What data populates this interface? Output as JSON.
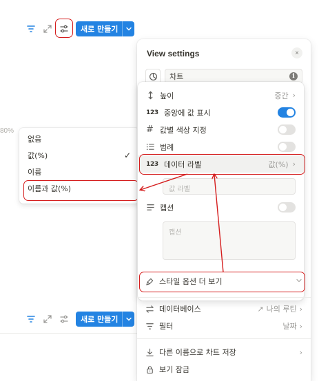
{
  "toolbar_top": {
    "new_label": "새로 만들기"
  },
  "toolbar_bottom": {
    "new_label": "새로 만들기"
  },
  "background": {
    "axis_label": "80%"
  },
  "submenu": {
    "items": [
      {
        "label": "없음",
        "checked": false
      },
      {
        "label": "값(%)",
        "checked": true,
        "check_mark": "✓"
      },
      {
        "label": "이름",
        "checked": false
      },
      {
        "label": "이름과 값(%)",
        "checked": false
      }
    ]
  },
  "panel": {
    "title": "View settings",
    "close_glyph": "×",
    "chart_name": "차트",
    "info_glyph": "i",
    "rows": {
      "height": {
        "label": "높이",
        "value": "중간"
      },
      "center_value": {
        "icon": "123",
        "label": "중앙에 값 표시",
        "on": true
      },
      "color_by_value": {
        "label": "값별 색상 지정",
        "on": false
      },
      "legend": {
        "label": "범례",
        "on": false
      },
      "data_labels": {
        "icon": "123",
        "label": "데이터 라벨",
        "value": "값(%)"
      },
      "caption": {
        "label": "캡션",
        "on": false
      }
    },
    "value_label_placeholder": "값 라벨",
    "caption_placeholder": "캡션",
    "style_more": "스타일 옵션 더 보기",
    "database": {
      "label": "데이터베이스",
      "value": "나의 루틴"
    },
    "filter": {
      "label": "필터",
      "value": "날짜"
    },
    "save_as": "다른 이름으로 차트 저장",
    "lock_view": "보기 잠금",
    "chevron": "›",
    "colors": {
      "accent": "#2383e2",
      "annotation": "#d51d1d"
    }
  }
}
